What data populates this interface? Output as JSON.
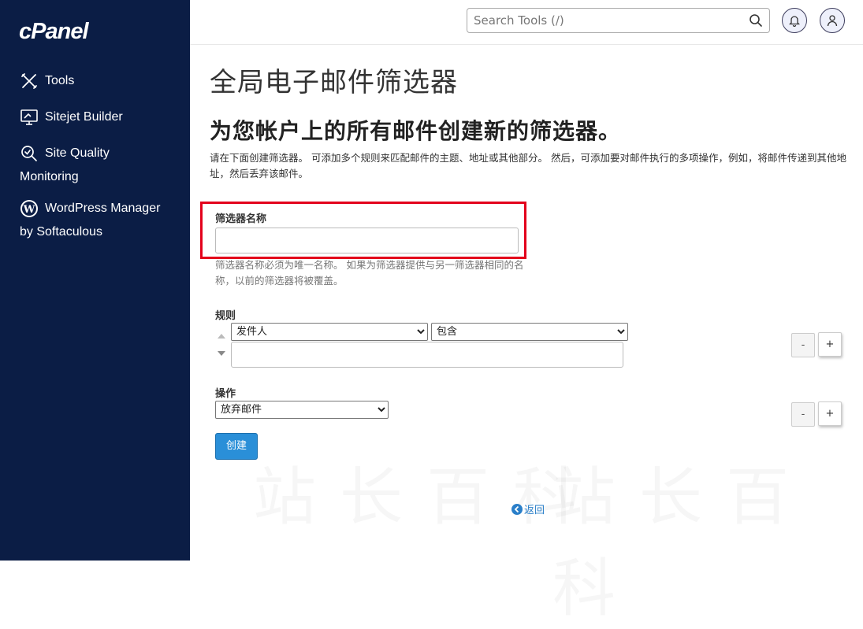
{
  "brand": {
    "logo_text": "cPanel"
  },
  "sidebar": {
    "items": [
      {
        "line1": "Tools",
        "line2": "",
        "icon": "tools-icon"
      },
      {
        "line1": "Sitejet Builder",
        "line2": "",
        "icon": "monitor-icon"
      },
      {
        "line1": "Site Quality",
        "line2": "Monitoring",
        "icon": "search-check-icon"
      },
      {
        "line1": "WordPress Manager",
        "line2": "by Softaculous",
        "icon": "wordpress-icon"
      }
    ]
  },
  "header": {
    "search_placeholder": "Search Tools (/)",
    "icons": [
      "search-icon",
      "bell-icon",
      "user-icon"
    ]
  },
  "main": {
    "page_title": "全局电子邮件筛选器",
    "subtitle": "为您帐户上的所有邮件创建新的筛选器。",
    "description": "请在下面创建筛选器。 可添加多个规则来匹配邮件的主题、地址或其他部分。 然后，可添加要对邮件执行的多项操作，例如，将邮件传递到其他地址，然后丢弃该邮件。",
    "filter_name_label": "筛选器名称",
    "filter_name_value": "",
    "filter_name_help": "筛选器名称必须为唯一名称。 如果为筛选器提供与另一筛选器相同的名称，以前的筛选器将被覆盖。",
    "rules_label": "规则",
    "rule_field_selected": "发件人",
    "rule_operator_selected": "包含",
    "rule_value": "",
    "actions_label": "操作",
    "action_selected": "放弃邮件",
    "minus_label": "-",
    "plus_label": "+",
    "create_button": "创建",
    "back_link": "返回"
  },
  "colors": {
    "sidebar_bg": "#0b1d45",
    "primary_button": "#2a8fd8",
    "highlight_box": "#e3001b",
    "link": "#2a7fc9"
  }
}
